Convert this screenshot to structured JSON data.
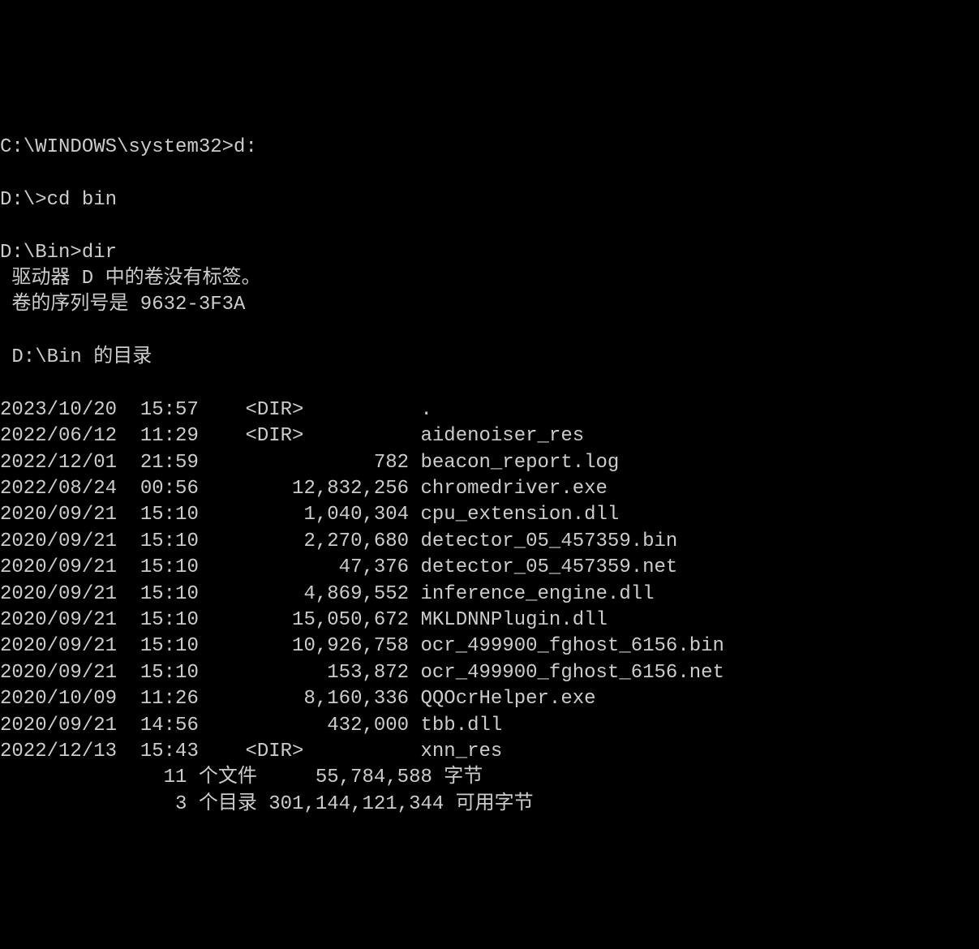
{
  "lines": {
    "l0": "C:\\WINDOWS\\system32>d:",
    "l1": "",
    "l2": "D:\\>cd bin",
    "l3": "",
    "l4": "D:\\Bin>dir",
    "l5": " 驱动器 D 中的卷没有标签。",
    "l6": " 卷的序列号是 9632-3F3A",
    "l7": "",
    "l8": " D:\\Bin 的目录",
    "l9": "",
    "l10": "2023/10/20  15:57    <DIR>          .",
    "l11": "2022/06/12  11:29    <DIR>          aidenoiser_res",
    "l12": "2022/12/01  21:59               782 beacon_report.log",
    "l13": "2022/08/24  00:56        12,832,256 chromedriver.exe",
    "l14": "2020/09/21  15:10         1,040,304 cpu_extension.dll",
    "l15": "2020/09/21  15:10         2,270,680 detector_05_457359.bin",
    "l16": "2020/09/21  15:10            47,376 detector_05_457359.net",
    "l17": "2020/09/21  15:10         4,869,552 inference_engine.dll",
    "l18": "2020/09/21  15:10        15,050,672 MKLDNNPlugin.dll",
    "l19": "2020/09/21  15:10        10,926,758 ocr_499900_fghost_6156.bin",
    "l20": "2020/09/21  15:10           153,872 ocr_499900_fghost_6156.net",
    "l21": "2020/10/09  11:26         8,160,336 QQOcrHelper.exe",
    "l22": "2020/09/21  14:56           432,000 tbb.dll",
    "l23": "2022/12/13  15:43    <DIR>          xnn_res",
    "l24": "              11 个文件     55,784,588 字节",
    "l25": "               3 个目录 301,144,121,344 可用字节"
  }
}
